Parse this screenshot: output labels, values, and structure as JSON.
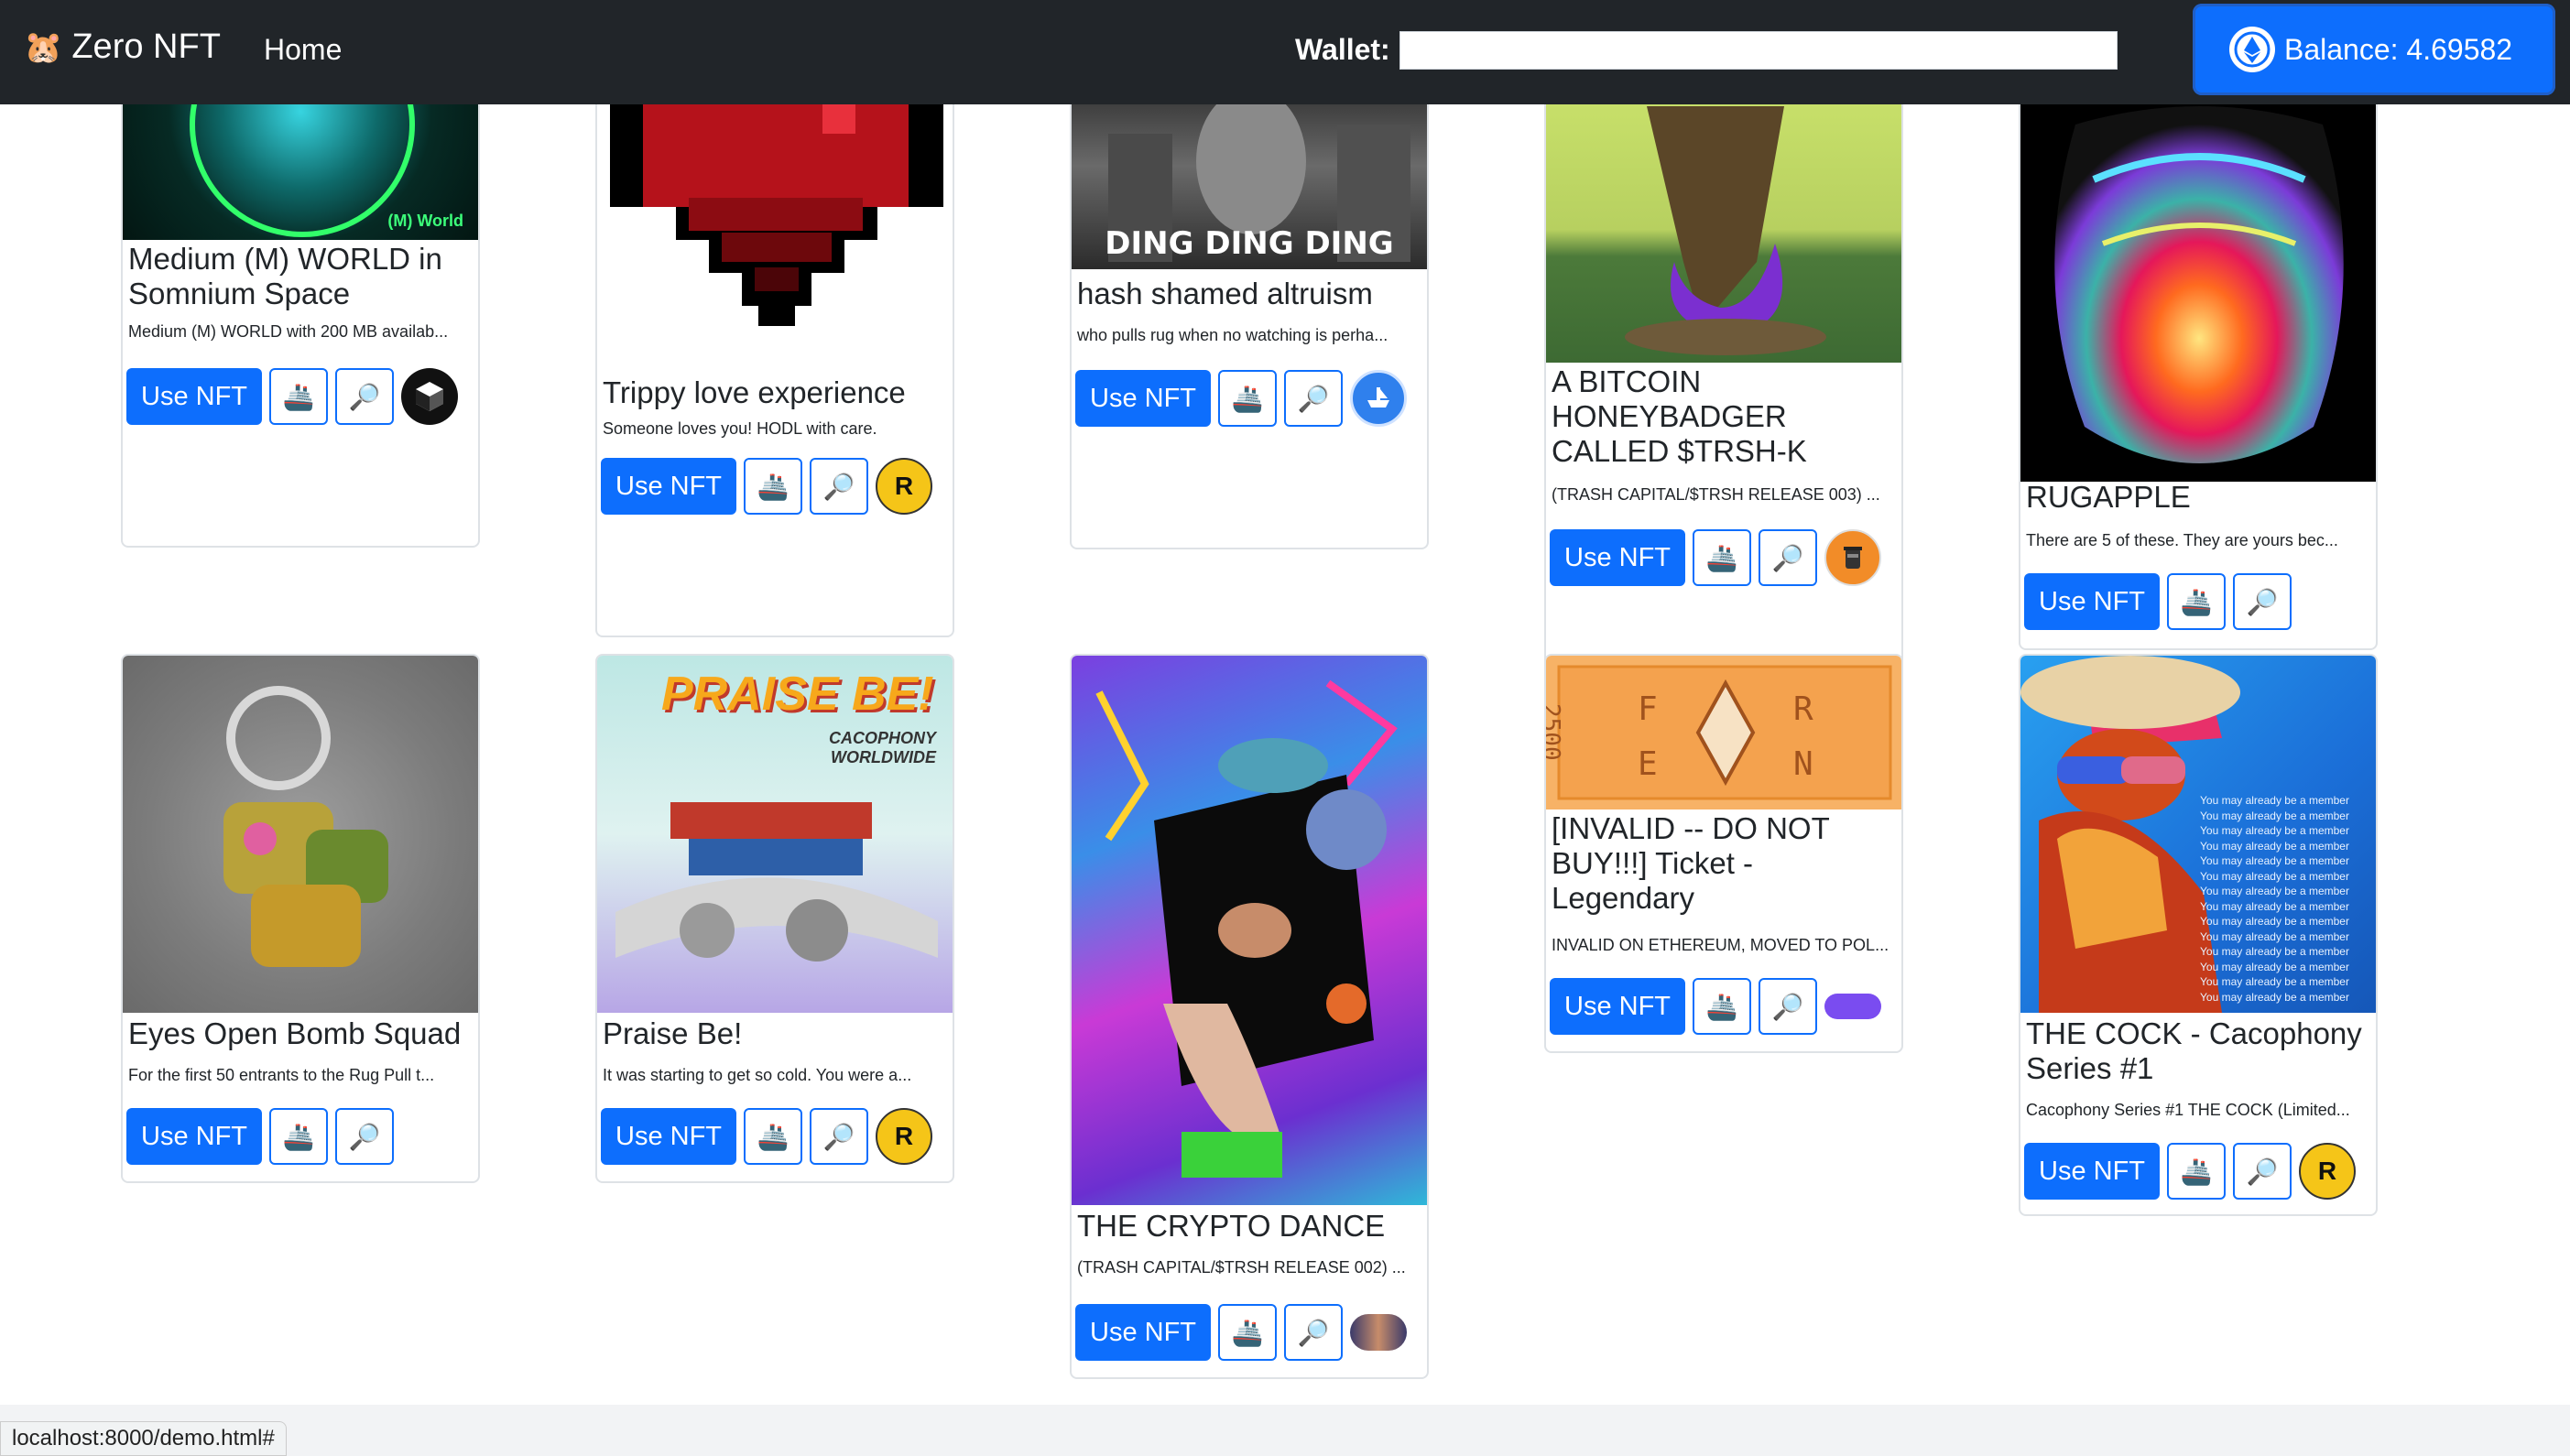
{
  "navbar": {
    "logo_emoji": "🐹",
    "brand": "Zero NFT",
    "home": "Home",
    "wallet_label": "Wallet:",
    "wallet_value": "",
    "balance": "Balance: 4.69582"
  },
  "card_actions": {
    "use_label": "Use NFT",
    "ship_icon": "🚢",
    "search_icon": "🔎"
  },
  "cards": [
    {
      "title": "Medium (M) WORLD in Somnium Space",
      "desc": "Medium (M) WORLD with 200 MB availab...",
      "badge": "cube",
      "img_text": "(M) World"
    },
    {
      "title": "Trippy love experience",
      "desc": "Someone loves you! HODL with care.",
      "badge": "R"
    },
    {
      "title": "hash shamed altruism",
      "desc": "who pulls rug when no watching is perha...",
      "badge": "ship",
      "img_text": "DING DING DING"
    },
    {
      "title": "A BITCOIN HONEYBADGER CALLED $TRSH-K",
      "desc": "(TRASH CAPITAL/$TRSH RELEASE 003) ...",
      "badge": "trash"
    },
    {
      "title": "RUGAPPLE",
      "desc": "There are 5 of these. They are yours bec...",
      "badge": ""
    },
    {
      "title": "Eyes Open Bomb Squad",
      "desc": "For the first 50 entrants to the Rug Pull t...",
      "badge": ""
    },
    {
      "title": "Praise Be!",
      "desc": "It was starting to get so cold. You were a...",
      "badge": "R",
      "img_text": "PRAISE BE!",
      "img_sub": "CACOPHONY WORLDWIDE"
    },
    {
      "title": "THE CRYPTO DANCE",
      "desc": "(TRASH CAPITAL/$TRSH RELEASE 002) ...",
      "badge": "pill"
    },
    {
      "title": "[INVALID -- DO NOT BUY!!!] Ticket - Legendary",
      "desc": "INVALID ON ETHEREUM, MOVED TO POL...",
      "badge": "ticket",
      "img_text": "2500"
    },
    {
      "title": "THE COCK - Cacophony Series #1",
      "desc": "Cacophony Series #1 THE COCK (Limited...",
      "badge": "R",
      "img_text": "You may already be a member"
    }
  ],
  "status_url": "localhost:8000/demo.html#",
  "colors": {
    "primary": "#0d6efd",
    "navbar": "#212529",
    "badge_yellow": "#f5c518",
    "badge_orange": "#f28c28"
  }
}
